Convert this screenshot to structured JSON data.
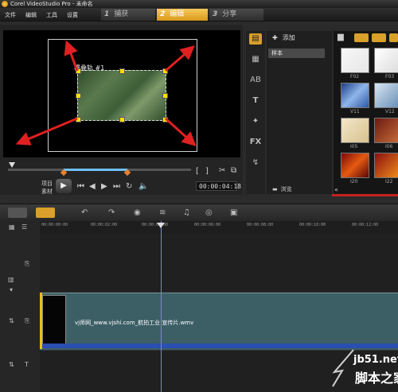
{
  "window": {
    "title": "Corel VideoStudio Pro - 未命名"
  },
  "menu": {
    "items": [
      "文件",
      "编辑",
      "工具",
      "设置"
    ]
  },
  "steps": [
    {
      "num": "1",
      "label": "捕获",
      "active": false
    },
    {
      "num": "2",
      "label": "编辑",
      "active": true
    },
    {
      "num": "3",
      "label": "分享",
      "active": false
    }
  ],
  "preview": {
    "overlay_label": "覆叠轨 #1",
    "mode_project": "项目",
    "mode_clip": "素材",
    "timecode": "00:00:04:18"
  },
  "library": {
    "add_label": "添加",
    "sample_label": "样本",
    "browse_label": "浏览",
    "thumbs": [
      "F02",
      "F03",
      "V11",
      "V12",
      "I05",
      "I06",
      "I20",
      "I22"
    ]
  },
  "timeline": {
    "ruler": [
      "00:00:00:00",
      "00:00:02:00",
      "00:00:04:00",
      "00:00:06:00",
      "00:00:08:00",
      "00:00:10:00",
      "00:00:12:00"
    ],
    "clip_name": "vj师网_www.vjshi.com_航拍工业 宣传片.wmv"
  },
  "watermark": {
    "line1": "jb51.net",
    "line2": "脚本之家"
  },
  "colors": {
    "accent": "#f0b030",
    "playhead": "#7a8ad0",
    "clip": "#3c5f66",
    "arrow": "#e02020"
  }
}
